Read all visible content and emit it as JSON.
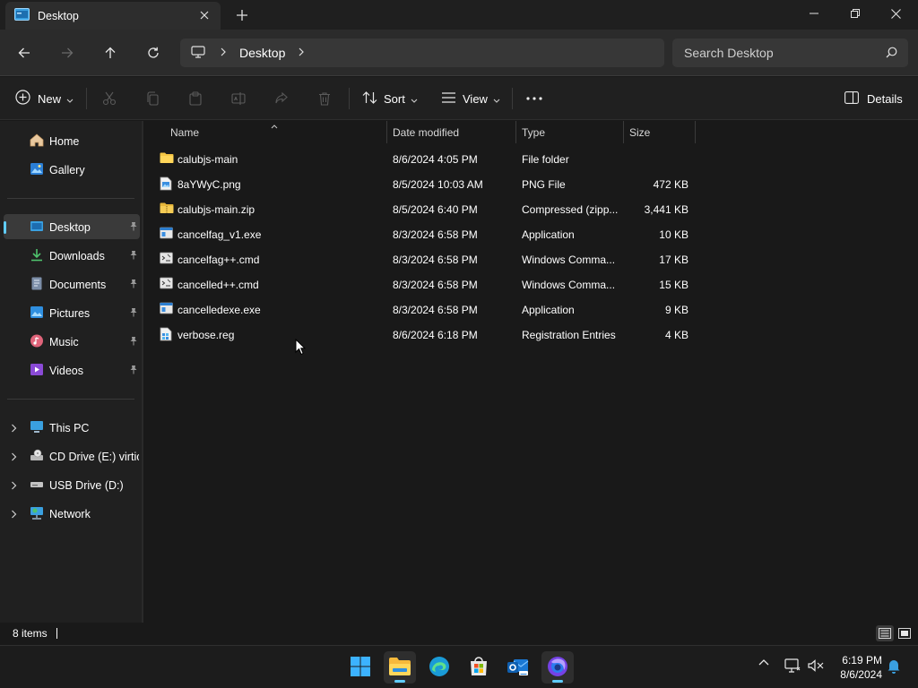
{
  "window": {
    "tab_title": "Desktop",
    "tab_icon": "desktop-folder-icon",
    "controls": [
      "minimize",
      "maximize",
      "close"
    ]
  },
  "address": {
    "crumbs": [
      "Desktop"
    ],
    "search_placeholder": "Search Desktop"
  },
  "commandbar": {
    "new_label": "New",
    "sort_label": "Sort",
    "view_label": "View",
    "details_label": "Details"
  },
  "sidebar": {
    "quick": [
      {
        "label": "Home",
        "icon": "home-icon"
      },
      {
        "label": "Gallery",
        "icon": "gallery-icon"
      }
    ],
    "pinned": [
      {
        "label": "Desktop",
        "icon": "desktop-icon",
        "selected": true
      },
      {
        "label": "Downloads",
        "icon": "downloads-icon"
      },
      {
        "label": "Documents",
        "icon": "documents-icon"
      },
      {
        "label": "Pictures",
        "icon": "pictures-icon"
      },
      {
        "label": "Music",
        "icon": "music-icon"
      },
      {
        "label": "Videos",
        "icon": "videos-icon"
      }
    ],
    "drives": [
      {
        "label": "This PC",
        "icon": "this-pc-icon"
      },
      {
        "label": "CD Drive (E:) virtio-",
        "icon": "cd-drive-icon"
      },
      {
        "label": "USB Drive (D:)",
        "icon": "usb-drive-icon"
      },
      {
        "label": "Network",
        "icon": "network-icon"
      }
    ]
  },
  "columns": {
    "name": "Name",
    "date": "Date modified",
    "type": "Type",
    "size": "Size"
  },
  "files": [
    {
      "name": "calubjs-main",
      "date": "8/6/2024 4:05 PM",
      "type": "File folder",
      "size": "",
      "icon": "folder-icon"
    },
    {
      "name": "8aYWyC.png",
      "date": "8/5/2024 10:03 AM",
      "type": "PNG File",
      "size": "472 KB",
      "icon": "image-file-icon"
    },
    {
      "name": "calubjs-main.zip",
      "date": "8/5/2024 6:40 PM",
      "type": "Compressed (zipp...",
      "size": "3,441 KB",
      "icon": "zip-folder-icon"
    },
    {
      "name": "cancelfag_v1.exe",
      "date": "8/3/2024 6:58 PM",
      "type": "Application",
      "size": "10 KB",
      "icon": "exe-icon"
    },
    {
      "name": "cancelfag++.cmd",
      "date": "8/3/2024 6:58 PM",
      "type": "Windows Comma...",
      "size": "17 KB",
      "icon": "cmd-file-icon"
    },
    {
      "name": "cancelled++.cmd",
      "date": "8/3/2024 6:58 PM",
      "type": "Windows Comma...",
      "size": "15 KB",
      "icon": "cmd-file-icon"
    },
    {
      "name": "cancelledexe.exe",
      "date": "8/3/2024 6:58 PM",
      "type": "Application",
      "size": "9 KB",
      "icon": "exe-icon"
    },
    {
      "name": "verbose.reg",
      "date": "8/6/2024 6:18 PM",
      "type": "Registration Entries",
      "size": "4 KB",
      "icon": "reg-file-icon"
    }
  ],
  "status": {
    "item_count": "8 items"
  },
  "taskbar": {
    "apps": [
      "start-icon",
      "file-explorer-icon",
      "edge-icon",
      "store-icon",
      "outlook-icon",
      "firefox-icon"
    ],
    "time": "6:19 PM",
    "date": "8/6/2024"
  },
  "colors": {
    "accent": "#60cdff",
    "folder": "#f6c644"
  }
}
